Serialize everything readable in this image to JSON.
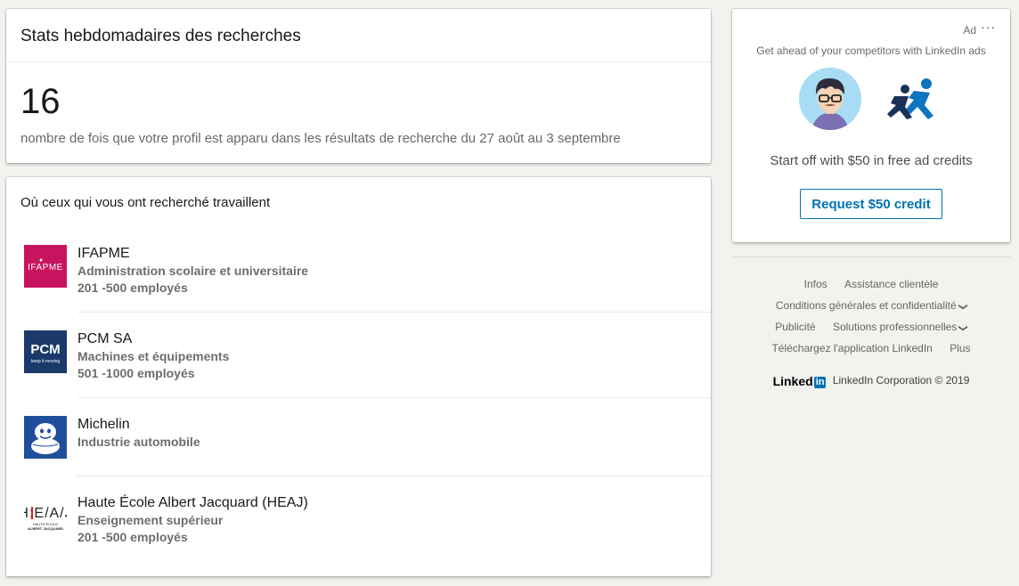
{
  "stats": {
    "title": "Stats hebdomadaires des recherches",
    "count": "16",
    "description": "nombre de fois que votre profil est apparu dans les résultats de recherche du 27 août au 3 septembre"
  },
  "companies": {
    "title": "Où ceux qui vous ont recherché travaillent",
    "items": [
      {
        "name": "IFAPME",
        "industry": "Administration scolaire et universitaire",
        "size": "201 -500 employés",
        "logo_text": "IFAPME",
        "logo_color": "#c2185b"
      },
      {
        "name": "PCM SA",
        "industry": "Machines et équipements",
        "size": "501 -1000 employés",
        "logo_text": "PCM",
        "logo_subtext": "keep it moving",
        "logo_color": "#1b3a6b"
      },
      {
        "name": "Michelin",
        "industry": "Industrie automobile",
        "logo_color": "#1f4e9c"
      },
      {
        "name": "Haute École Albert Jacquard (HEAJ)",
        "industry": "Enseignement supérieur",
        "size": "201 -500 employés",
        "logo_text": "HE/AJ",
        "logo_subtext1": "HAUTE ÉCOLE",
        "logo_subtext2": "ALBERT JACQUARD"
      }
    ]
  },
  "ad": {
    "label": "Ad",
    "more": "···",
    "tagline": "Get ahead of your competitors with LinkedIn ads",
    "offer": "Start off with $50 in free ad credits",
    "button": "Request $50 credit",
    "accent": "#0073b1"
  },
  "footer": {
    "row1": [
      "Infos",
      "Assistance clientèle"
    ],
    "row2": [
      "Conditions générales et confidentialité"
    ],
    "row3": [
      "Publicité",
      "Solutions professionnelles"
    ],
    "row4": [
      "Téléchargez l'application LinkedIn",
      "Plus"
    ],
    "logo_word": "Linked",
    "logo_box": "in",
    "copyright": "LinkedIn Corporation © 2019"
  }
}
